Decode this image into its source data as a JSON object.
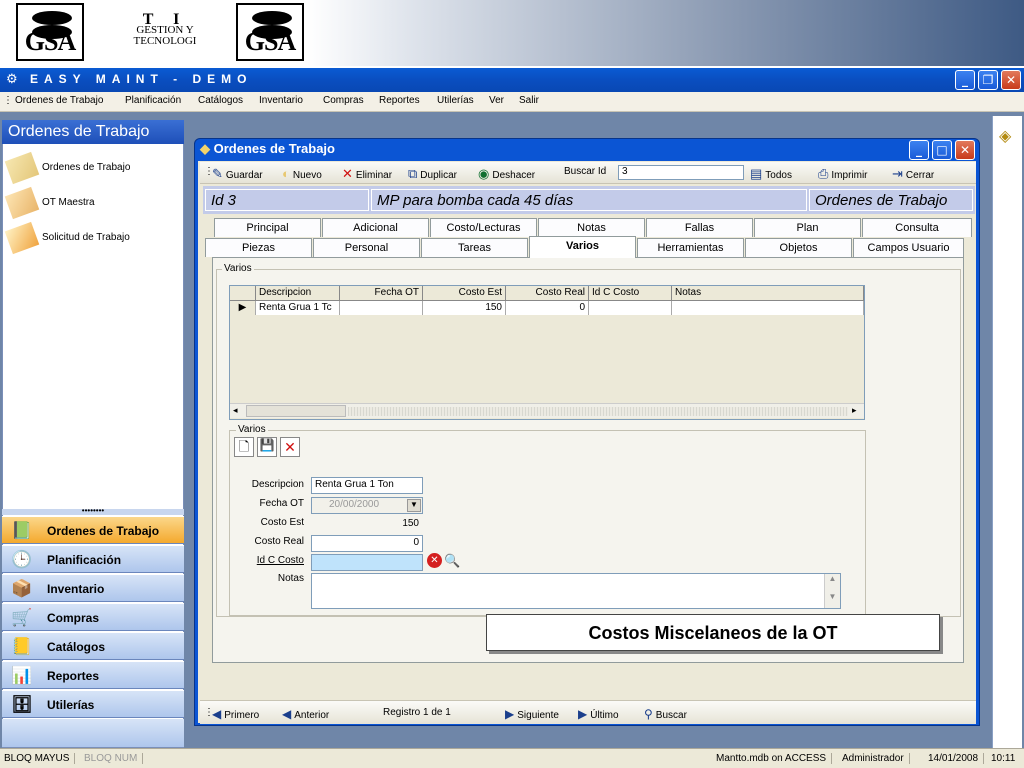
{
  "banner": {
    "logo_left": "GSA",
    "logo_right": "GSA",
    "ti_big": "T I",
    "ti_line1": "GESTION Y",
    "ti_line2": "TECNOLOGI",
    "registered": "®"
  },
  "app": {
    "title": "EASY MAINT - DEMO"
  },
  "menu": [
    "Ordenes de Trabajo",
    "Planificación",
    "Catálogos",
    "Inventario",
    "Compras",
    "Reportes",
    "Utilerías",
    "Ver",
    "Salir"
  ],
  "left_pane": {
    "title": "Ordenes de Trabajo",
    "items": [
      "Ordenes de Trabajo",
      "OT Maestra",
      "Solicitud de Trabajo"
    ],
    "nav": [
      {
        "label": "Ordenes de Trabajo",
        "icon": "📗"
      },
      {
        "label": "Planificación",
        "icon": "🕒"
      },
      {
        "label": "Inventario",
        "icon": "📦"
      },
      {
        "label": "Compras",
        "icon": "🛒"
      },
      {
        "label": "Catálogos",
        "icon": "📒"
      },
      {
        "label": "Reportes",
        "icon": "📊"
      },
      {
        "label": "Utilerías",
        "icon": "🗄"
      }
    ]
  },
  "window": {
    "title": "Ordenes de Trabajo",
    "toolbar": {
      "guardar": "Guardar",
      "nuevo": "Nuevo",
      "eliminar": "Eliminar",
      "duplicar": "Duplicar",
      "deshacer": "Deshacer",
      "buscar_id": "Buscar Id",
      "id_value": "3",
      "todos": "Todos",
      "imprimir": "Imprimir",
      "cerrar": "Cerrar"
    },
    "info": {
      "id": "Id  3",
      "description": "MP para bomba cada 45 días",
      "module": "Ordenes de Trabajo"
    },
    "tabs_row1": [
      "Principal",
      "Adicional",
      "Costo/Lecturas",
      "Notas",
      "Fallas",
      "Plan",
      "Consulta"
    ],
    "tabs_row2": [
      "Piezas",
      "Personal",
      "Tareas",
      "Varios",
      "Herramientas",
      "Objetos",
      "Campos Usuario"
    ],
    "selected_tab": "Varios",
    "group1_label": "Varios",
    "grid": {
      "columns": [
        "Descripcion",
        "Fecha OT",
        "Costo Est",
        "Costo Real",
        "Id C Costo",
        "Notas"
      ],
      "rows": [
        [
          "Renta Grua 1 Tc",
          "",
          "150",
          "0",
          "",
          ""
        ]
      ]
    },
    "group2_label": "Varios",
    "form": {
      "descripcion_label": "Descripcion",
      "descripcion_value": "Renta Grua 1 Ton",
      "fecha_label": "Fecha OT",
      "fecha_value": "20/00/2000",
      "costo_est_label": "Costo Est",
      "costo_est_value": "150",
      "costo_real_label": "Costo Real",
      "costo_real_value": "0",
      "id_costo_label": "Id C Costo",
      "id_costo_value": "",
      "notas_label": "Notas",
      "notas_value": ""
    },
    "callout": "Costos Miscelaneos de la OT",
    "nav": {
      "primero": "Primero",
      "anterior": "Anterior",
      "registro": "Registro 1 de 1",
      "siguiente": "Siguiente",
      "ultimo": "Último",
      "buscar": "Buscar"
    }
  },
  "status": {
    "caps": "BLOQ MAYUS",
    "num": "BLOQ NUM",
    "db": "Mantto.mdb on ACCESS",
    "user": "Administrador",
    "date": "14/01/2008",
    "time": "10:11"
  },
  "colors": {
    "title_blue": "#0a5bd3",
    "nav_active": "#f4a92e",
    "info_bar": "#c3cbe9",
    "id_costo_field": "#bfe3fb"
  }
}
